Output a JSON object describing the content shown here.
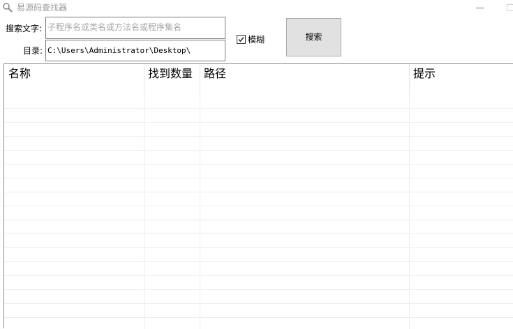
{
  "window": {
    "title": "易源码查找器",
    "icon": "magnifier-icon"
  },
  "form": {
    "search_label": "搜索文字:",
    "search_placeholder": "子程序名或类名或方法名或程序集名",
    "dir_label": "目录:",
    "dir_value": "C:\\Users\\Administrator\\Desktop\\",
    "fuzzy_label": "模糊",
    "fuzzy_checked": true,
    "search_button": "搜索"
  },
  "table": {
    "columns": [
      "名称",
      "找到数量",
      "路径",
      "提示"
    ],
    "rows": []
  }
}
